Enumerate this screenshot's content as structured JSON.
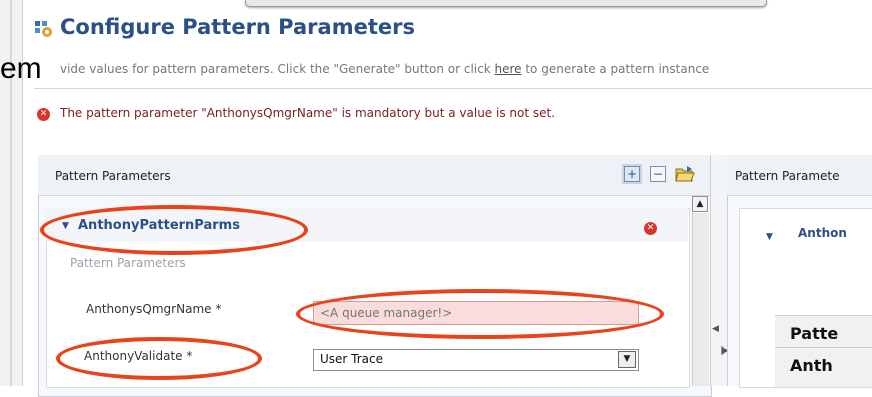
{
  "header": {
    "title": "Configure Pattern Parameters",
    "description_before": "vide values for pattern parameters. Click the \"Generate\" button or click ",
    "description_link": "here",
    "description_after": " to generate a pattern instance"
  },
  "overlay_text": "em",
  "error": {
    "message": "The pattern parameter \"AnthonysQmgrName\" is mandatory but a value is not set."
  },
  "left_panel": {
    "title": "Pattern Parameters",
    "toolbar": {
      "expand_icon": "expand-all-icon",
      "collapse_icon": "collapse-all-icon",
      "open_icon": "open-folder-icon"
    },
    "section": {
      "title": "AnthonyPatternParms",
      "subtitle": "Pattern Parameters",
      "fields": [
        {
          "label": "AnthonysQmgrName *",
          "placeholder": "<A queue manager!>",
          "value": ""
        },
        {
          "label": "AnthonyValidate *",
          "value": "User Trace"
        }
      ]
    }
  },
  "right_panel": {
    "title": "Pattern Paramete",
    "section_title": "Anthon",
    "rows": [
      "Patte",
      "Anth"
    ]
  },
  "colors": {
    "accent": "#2b4f86",
    "error": "#d9362b",
    "annotation": "#e8431a",
    "invalid_field": "#fbdcdc"
  }
}
